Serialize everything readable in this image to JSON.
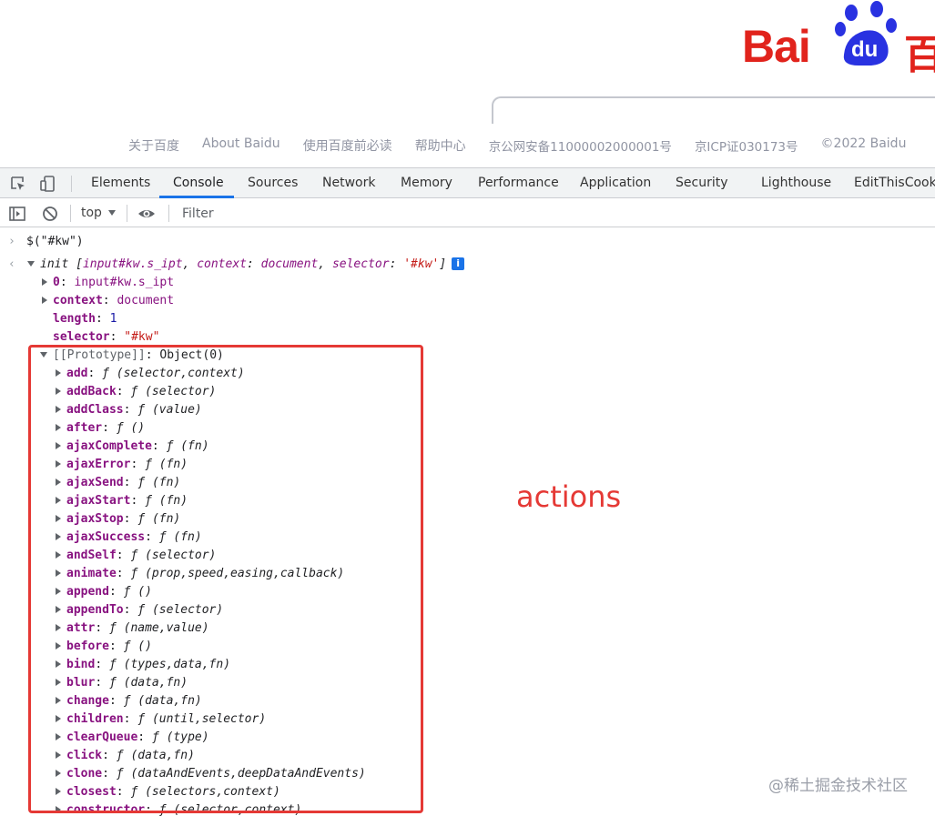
{
  "baidu": {
    "logo_text": "Bai",
    "logo_paw_text": "du",
    "logo_suffix": "百",
    "footer_links": [
      "关于百度",
      "About Baidu",
      "使用百度前必读",
      "帮助中心",
      "京公网安备11000002000001号",
      "京ICP证030173号",
      "©2022 Baidu"
    ]
  },
  "devtools": {
    "tabs": [
      {
        "label": "Elements",
        "active": false
      },
      {
        "label": "Console",
        "active": true
      },
      {
        "label": "Sources",
        "active": false
      },
      {
        "label": "Network",
        "active": false
      },
      {
        "label": "Memory",
        "active": false
      },
      {
        "label": "Performance",
        "active": false
      },
      {
        "label": "Application",
        "active": false
      },
      {
        "label": "Security",
        "active": false
      },
      {
        "label": "Lighthouse",
        "active": false
      },
      {
        "label": "EditThisCooki",
        "active": false
      }
    ],
    "icons": [
      "inspect-element-icon",
      "device-toggle-icon",
      "sidebar-toggle-icon",
      "clear-console-icon",
      "live-expression-eye-icon"
    ],
    "context": "top",
    "filter_placeholder": "Filter"
  },
  "console": {
    "input": "$(\"#kw\")",
    "result_summary": {
      "name": "init",
      "open": "[",
      "p1": "input#kw.s_ipt",
      "sep1": ", ",
      "k2": "context",
      "v2": "document",
      "sep2": ", ",
      "k3": "selector",
      "v3": "'#kw'",
      "close": "]",
      "info": "i"
    },
    "props": [
      {
        "key": "0",
        "value": "input#kw.s_ipt"
      },
      {
        "key": "context",
        "value": "document"
      },
      {
        "key": "length",
        "value": "1"
      },
      {
        "key": "selector",
        "value": "\"#kw\""
      }
    ],
    "prototype_label": "[[Prototype]]",
    "prototype_value": "Object(0)",
    "methods": [
      {
        "name": "add",
        "sig": "(selector,context)"
      },
      {
        "name": "addBack",
        "sig": "(selector)"
      },
      {
        "name": "addClass",
        "sig": "(value)"
      },
      {
        "name": "after",
        "sig": "()"
      },
      {
        "name": "ajaxComplete",
        "sig": "(fn)"
      },
      {
        "name": "ajaxError",
        "sig": "(fn)"
      },
      {
        "name": "ajaxSend",
        "sig": "(fn)"
      },
      {
        "name": "ajaxStart",
        "sig": "(fn)"
      },
      {
        "name": "ajaxStop",
        "sig": "(fn)"
      },
      {
        "name": "ajaxSuccess",
        "sig": "(fn)"
      },
      {
        "name": "andSelf",
        "sig": "(selector)"
      },
      {
        "name": "animate",
        "sig": "(prop,speed,easing,callback)"
      },
      {
        "name": "append",
        "sig": "()"
      },
      {
        "name": "appendTo",
        "sig": "(selector)"
      },
      {
        "name": "attr",
        "sig": "(name,value)"
      },
      {
        "name": "before",
        "sig": "()"
      },
      {
        "name": "bind",
        "sig": "(types,data,fn)"
      },
      {
        "name": "blur",
        "sig": "(data,fn)"
      },
      {
        "name": "change",
        "sig": "(data,fn)"
      },
      {
        "name": "children",
        "sig": "(until,selector)"
      },
      {
        "name": "clearQueue",
        "sig": "(type)"
      },
      {
        "name": "click",
        "sig": "(data,fn)"
      },
      {
        "name": "clone",
        "sig": "(dataAndEvents,deepDataAndEvents)"
      },
      {
        "name": "closest",
        "sig": "(selectors,context)"
      },
      {
        "name": "constructor",
        "sig": "(selector,context)"
      }
    ],
    "f_glyph": "ƒ"
  },
  "annotation": "actions",
  "watermark": "@稀土掘金技术社区",
  "colors": {
    "baidu_red": "#e1231c",
    "baidu_blue": "#2932e1",
    "tab_active_underline": "#1a73e8",
    "highlight_red": "#e53935"
  }
}
